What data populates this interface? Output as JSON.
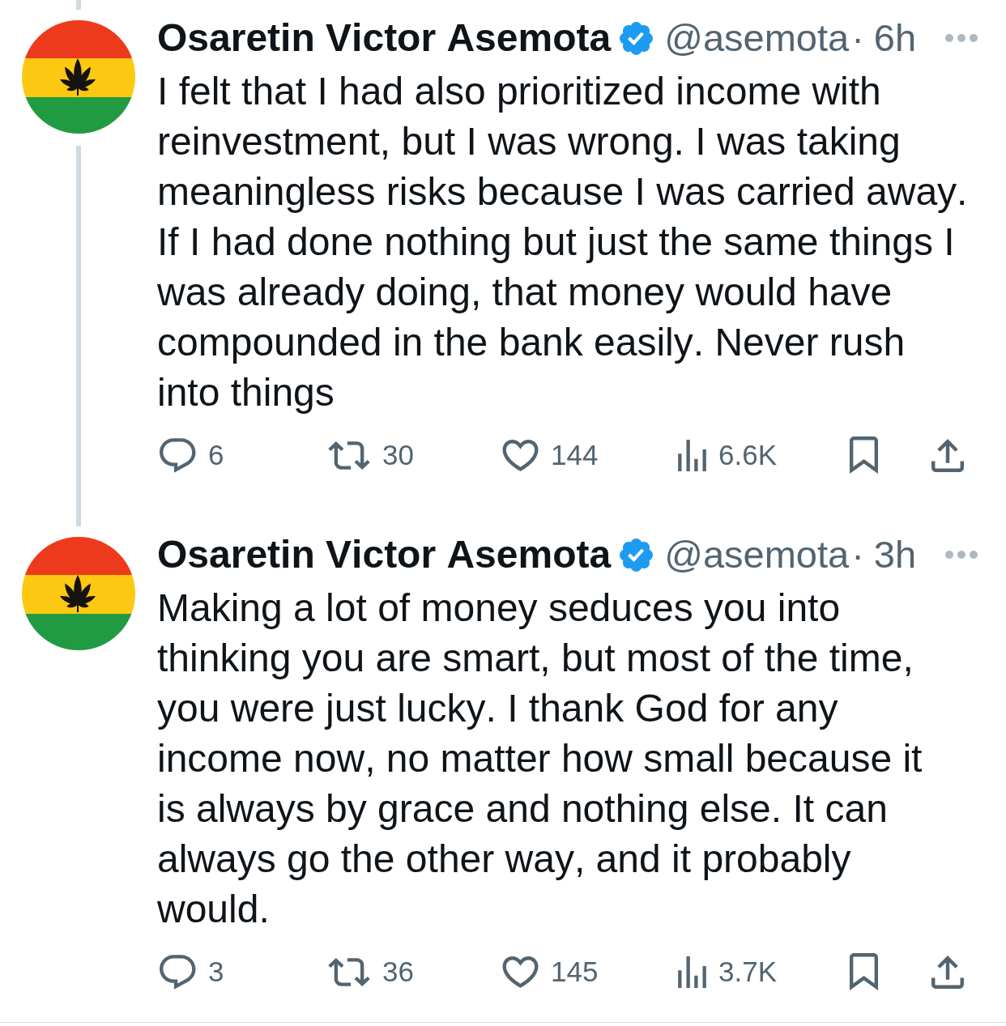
{
  "tweets": [
    {
      "thread_above": true,
      "thread_below": true,
      "author": {
        "name": "Osaretin Victor Asemota",
        "verified": true,
        "handle": "@asemota"
      },
      "separator": "·",
      "time": "6h",
      "text": "I felt that I had also prioritized income with reinvestment, but I was wrong. I was taking meaningless risks because I was carried away. If I had done nothing but just the same things I was already doing, that money would have compounded in the bank easily. Never rush into things",
      "actions": [
        {
          "kind": "reply",
          "count": "6"
        },
        {
          "kind": "repost",
          "count": "30"
        },
        {
          "kind": "like",
          "count": "144"
        },
        {
          "kind": "views",
          "count": "6.6K"
        },
        {
          "kind": "bookmark"
        },
        {
          "kind": "share"
        }
      ]
    },
    {
      "thread_above": false,
      "thread_below": false,
      "author": {
        "name": "Osaretin Victor Asemota",
        "verified": true,
        "handle": "@asemota"
      },
      "separator": "·",
      "time": "3h",
      "text": "Making a lot of money seduces you into thinking you are smart, but most of the time, you were just lucky. I thank God for any income now, no matter how small because it is always by grace and nothing else. It can always go the other way, and it probably would.",
      "actions": [
        {
          "kind": "reply",
          "count": "3"
        },
        {
          "kind": "repost",
          "count": "36"
        },
        {
          "kind": "like",
          "count": "145"
        },
        {
          "kind": "views",
          "count": "3.7K"
        },
        {
          "kind": "bookmark"
        },
        {
          "kind": "share"
        }
      ]
    }
  ]
}
